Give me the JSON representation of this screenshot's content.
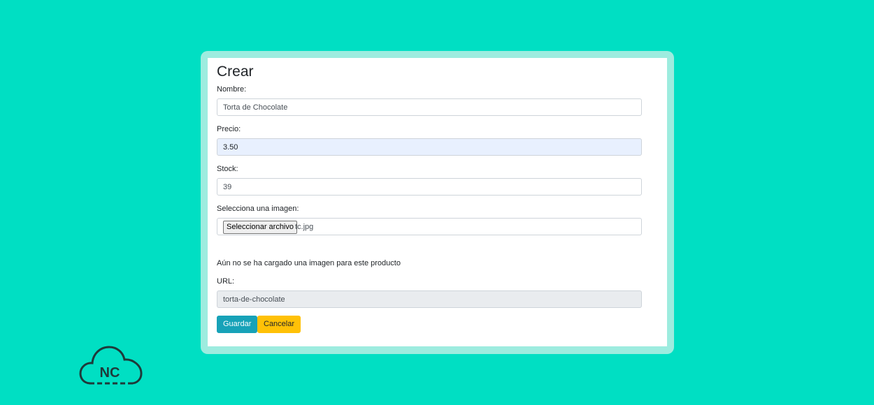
{
  "form": {
    "title": "Crear",
    "nombre_label": "Nombre:",
    "nombre_value": "Torta de Chocolate",
    "precio_label": "Precio:",
    "precio_value": "3.50",
    "stock_label": "Stock:",
    "stock_value": "39",
    "imagen_label": "Selecciona una imagen:",
    "file_button_label": "Seleccionar archivo",
    "file_name": "tc.jpg",
    "no_image_note": "Aún no se ha cargado una imagen para este producto",
    "url_label": "URL:",
    "url_value": "torta-de-chocolate",
    "save_label": "Guardar",
    "cancel_label": "Cancelar"
  },
  "brand": {
    "logo_text": "NC"
  },
  "colors": {
    "background": "#00dfc3",
    "frame": "#9decdf",
    "save_button": "#17a2b8",
    "cancel_button": "#ffc107",
    "logo_stroke": "#1f3a3a"
  }
}
